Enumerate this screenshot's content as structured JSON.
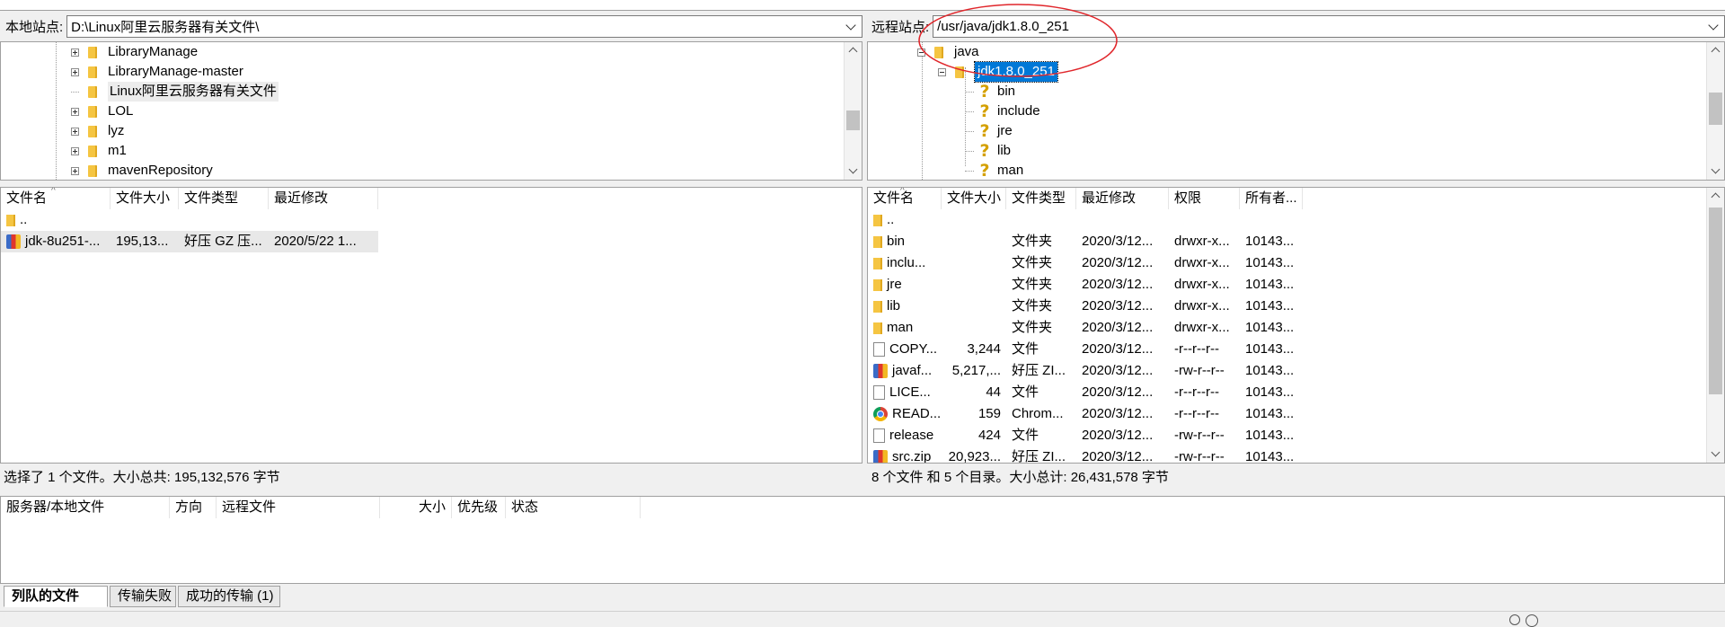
{
  "local": {
    "site_label": "本地站点:",
    "path": "D:\\Linux阿里云服务器有关文件\\",
    "tree": [
      {
        "label": "LibraryManage",
        "expandable": true
      },
      {
        "label": "LibraryManage-master",
        "expandable": true
      },
      {
        "label": "Linux阿里云服务器有关文件",
        "expandable": false
      },
      {
        "label": "LOL",
        "expandable": true
      },
      {
        "label": "lyz",
        "expandable": true
      },
      {
        "label": "m1",
        "expandable": true
      },
      {
        "label": "mavenRepository",
        "expandable": true
      }
    ],
    "columns": [
      "文件名",
      "文件大小",
      "文件类型",
      "最近修改"
    ],
    "files": [
      {
        "name": "..",
        "size": "",
        "type": "",
        "modified": "",
        "icon": "folder"
      },
      {
        "name": "jdk-8u251-...",
        "size": "195,13...",
        "type": "好压 GZ 压...",
        "modified": "2020/5/22 1...",
        "icon": "archive"
      }
    ],
    "status": "选择了 1 个文件。大小总共: 195,132,576 字节"
  },
  "remote": {
    "site_label": "远程站点:",
    "path": "/usr/java/jdk1.8.0_251",
    "tree_parent": "java",
    "tree_selected": "jdk1.8.0_251",
    "tree_children": [
      "bin",
      "include",
      "jre",
      "lib",
      "man"
    ],
    "columns": [
      "文件名",
      "文件大小",
      "文件类型",
      "最近修改",
      "权限",
      "所有者..."
    ],
    "files": [
      {
        "name": "..",
        "size": "",
        "type": "",
        "modified": "",
        "perm": "",
        "owner": "",
        "icon": "folder"
      },
      {
        "name": "bin",
        "size": "",
        "type": "文件夹",
        "modified": "2020/3/12...",
        "perm": "drwxr-x...",
        "owner": "10143...",
        "icon": "folder"
      },
      {
        "name": "inclu...",
        "size": "",
        "type": "文件夹",
        "modified": "2020/3/12...",
        "perm": "drwxr-x...",
        "owner": "10143...",
        "icon": "folder"
      },
      {
        "name": "jre",
        "size": "",
        "type": "文件夹",
        "modified": "2020/3/12...",
        "perm": "drwxr-x...",
        "owner": "10143...",
        "icon": "folder"
      },
      {
        "name": "lib",
        "size": "",
        "type": "文件夹",
        "modified": "2020/3/12...",
        "perm": "drwxr-x...",
        "owner": "10143...",
        "icon": "folder"
      },
      {
        "name": "man",
        "size": "",
        "type": "文件夹",
        "modified": "2020/3/12...",
        "perm": "drwxr-x...",
        "owner": "10143...",
        "icon": "folder"
      },
      {
        "name": "COPY...",
        "size": "3,244",
        "type": "文件",
        "modified": "2020/3/12...",
        "perm": "-r--r--r--",
        "owner": "10143...",
        "icon": "file"
      },
      {
        "name": "javaf...",
        "size": "5,217,...",
        "type": "好压 ZI...",
        "modified": "2020/3/12...",
        "perm": "-rw-r--r--",
        "owner": "10143...",
        "icon": "archive"
      },
      {
        "name": "LICE...",
        "size": "44",
        "type": "文件",
        "modified": "2020/3/12...",
        "perm": "-r--r--r--",
        "owner": "10143...",
        "icon": "file"
      },
      {
        "name": "READ...",
        "size": "159",
        "type": "Chrom...",
        "modified": "2020/3/12...",
        "perm": "-r--r--r--",
        "owner": "10143...",
        "icon": "chrome"
      },
      {
        "name": "release",
        "size": "424",
        "type": "文件",
        "modified": "2020/3/12...",
        "perm": "-rw-r--r--",
        "owner": "10143...",
        "icon": "file"
      },
      {
        "name": "src.zip",
        "size": "20,923...",
        "type": "好压 ZI...",
        "modified": "2020/3/12...",
        "perm": "-rw-r--r--",
        "owner": "10143...",
        "icon": "archive"
      }
    ],
    "status": "8 个文件 和 5 个目录。大小总计: 26,431,578 字节"
  },
  "queue": {
    "columns": [
      "服务器/本地文件",
      "方向",
      "远程文件",
      "大小",
      "优先级",
      "状态"
    ],
    "tabs": [
      "列队的文件",
      "传输失败",
      "成功的传输 (1)"
    ]
  },
  "colors": {
    "selection": "#0078d7",
    "annotation_circle": "#e0262b"
  }
}
